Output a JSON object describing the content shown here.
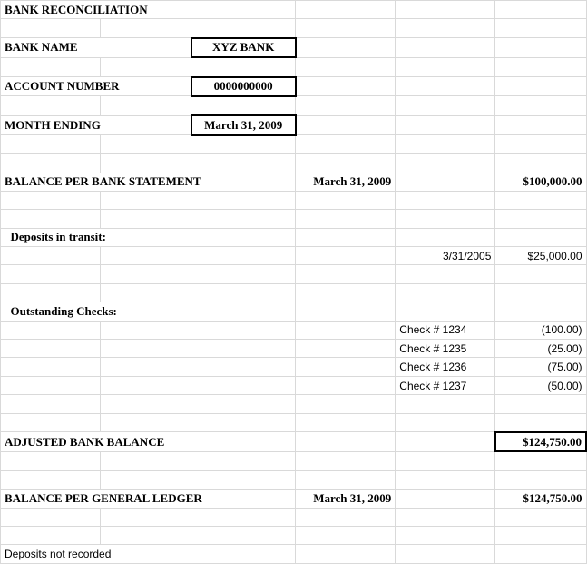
{
  "header": {
    "title": "BANK RECONCILIATION",
    "bank_name_label": "BANK NAME",
    "bank_name_value": "XYZ BANK",
    "account_number_label": "ACCOUNT NUMBER",
    "account_number_value": "0000000000",
    "month_ending_label": "MONTH ENDING",
    "month_ending_value": "March 31, 2009"
  },
  "balance_per_bank": {
    "label": "BALANCE PER BANK STATEMENT",
    "date": "March 31, 2009",
    "amount": "$100,000.00"
  },
  "deposits_in_transit": {
    "label": "Deposits in transit:",
    "items": [
      {
        "date": "3/31/2005",
        "amount": "$25,000.00"
      }
    ]
  },
  "outstanding_checks": {
    "label": "Outstanding Checks:",
    "items": [
      {
        "desc": "Check # 1234",
        "amount": "(100.00)"
      },
      {
        "desc": "Check # 1235",
        "amount": "(25.00)"
      },
      {
        "desc": "Check # 1236",
        "amount": "(75.00)"
      },
      {
        "desc": "Check # 1237",
        "amount": "(50.00)"
      }
    ]
  },
  "adjusted_bank_balance": {
    "label": "ADJUSTED BANK BALANCE",
    "amount": "$124,750.00"
  },
  "balance_per_ledger": {
    "label": "BALANCE PER GENERAL LEDGER",
    "date": "March 31, 2009",
    "amount": "$124,750.00"
  },
  "deposits_not_recorded": {
    "label": "Deposits not recorded"
  }
}
